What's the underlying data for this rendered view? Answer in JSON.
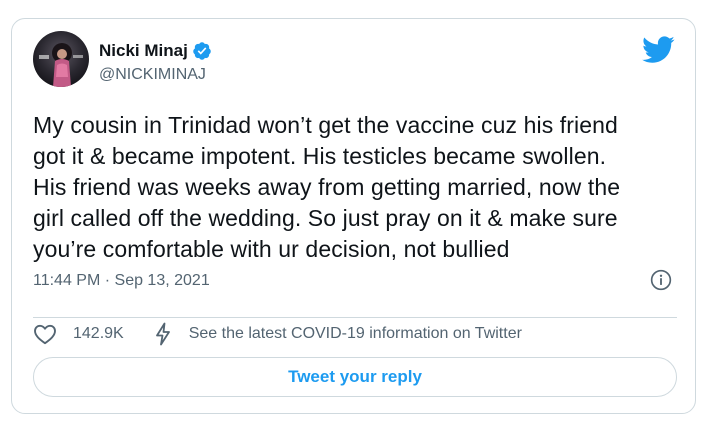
{
  "author": {
    "display_name": "Nicki Minaj",
    "handle": "@NICKIMINAJ",
    "verified_icon": "verified-badge-icon",
    "avatar_icon": "profile-avatar"
  },
  "tweet": {
    "text_lines": [
      "My cousin in Trinidad won’t get the vaccine cuz his friend",
      "got it & became impotent. His testicles became swollen.",
      "His friend was weeks away from getting married, now the",
      "girl called off the wedding. So just pray on it & make sure",
      "you’re comfortable with ur decision, not bullied"
    ],
    "timestamp": "11:44 PM · Sep 13, 2021"
  },
  "actions": {
    "like_count": "142.9K",
    "covid_info": "See the latest COVID-19 information on Twitter"
  },
  "reply_button": {
    "label": "Tweet your reply"
  },
  "colors": {
    "twitter_blue": "#1d9bf0",
    "text_primary": "#0f1419",
    "text_secondary": "#536471",
    "border": "#cfd9de"
  }
}
